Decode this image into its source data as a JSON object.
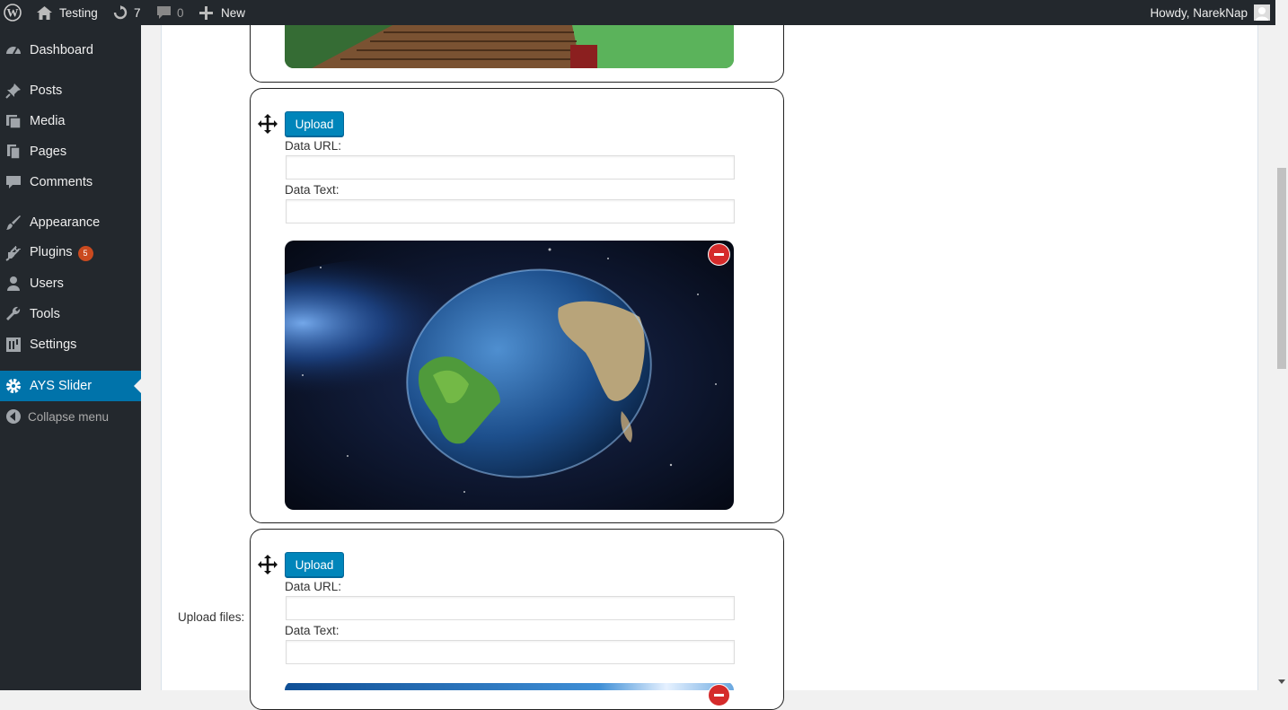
{
  "adminbar": {
    "site_name": "Testing",
    "updates_count": "7",
    "comments_count": "0",
    "new_label": "New",
    "greeting": "Howdy, NarekNap"
  },
  "sidebar": {
    "items": [
      {
        "label": "Dashboard",
        "icon": "dashboard-icon"
      },
      {
        "label": "Posts",
        "icon": "pin-icon"
      },
      {
        "label": "Media",
        "icon": "media-icon"
      },
      {
        "label": "Pages",
        "icon": "pages-icon"
      },
      {
        "label": "Comments",
        "icon": "comment-icon"
      },
      {
        "label": "Appearance",
        "icon": "brush-icon"
      },
      {
        "label": "Plugins",
        "icon": "plugin-icon",
        "badge": "5"
      },
      {
        "label": "Users",
        "icon": "user-icon"
      },
      {
        "label": "Tools",
        "icon": "wrench-icon"
      },
      {
        "label": "Settings",
        "icon": "settings-icon"
      },
      {
        "label": "AYS Slider",
        "icon": "gear-icon",
        "active": true
      }
    ],
    "collapse_label": "Collapse menu"
  },
  "slides": [
    {
      "image": "wooden-boardwalk-image"
    },
    {
      "upload_label": "Upload",
      "url_label": "Data URL:",
      "url_value": "",
      "text_label": "Data Text:",
      "text_value": "",
      "image": "earth-in-space-image"
    },
    {
      "upload_label": "Upload",
      "url_label": "Data URL:",
      "url_value": "",
      "text_label": "Data Text:",
      "text_value": "",
      "image": "blue-sky-image"
    }
  ],
  "form": {
    "upload_files_label": "Upload files:"
  },
  "colors": {
    "accent": "#0073aa",
    "button": "#0085ba",
    "remove": "#d52b2b",
    "badge": "#ca4a1f"
  }
}
